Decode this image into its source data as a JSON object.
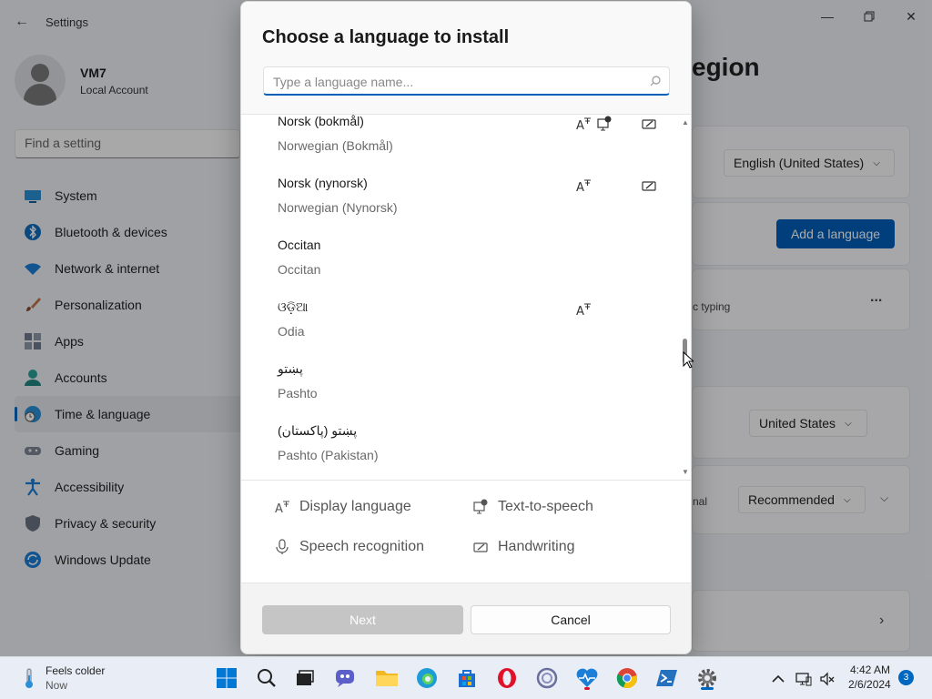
{
  "settings": {
    "title": "Settings",
    "profile": {
      "name": "VM7",
      "account": "Local Account"
    },
    "find_placeholder": "Find a setting",
    "nav": [
      {
        "label": "System",
        "icon": "monitor-icon"
      },
      {
        "label": "Bluetooth & devices",
        "icon": "bluetooth-icon"
      },
      {
        "label": "Network & internet",
        "icon": "wifi-icon"
      },
      {
        "label": "Personalization",
        "icon": "brush-icon"
      },
      {
        "label": "Apps",
        "icon": "apps-icon"
      },
      {
        "label": "Accounts",
        "icon": "person-icon"
      },
      {
        "label": "Time & language",
        "icon": "globe-clock-icon"
      },
      {
        "label": "Gaming",
        "icon": "gamepad-icon"
      },
      {
        "label": "Accessibility",
        "icon": "accessibility-icon"
      },
      {
        "label": "Privacy & security",
        "icon": "shield-icon"
      },
      {
        "label": "Windows Update",
        "icon": "update-icon"
      }
    ],
    "page_title_fragment": "egion",
    "language_select": "English (United States)",
    "add_language_button": "Add a language",
    "typing_fragment": "c typing",
    "more": "...",
    "region_select": "United States",
    "format_fragment": "nal",
    "format_select": "Recommended"
  },
  "dialog": {
    "title": "Choose a language to install",
    "search_placeholder": "Type a language name...",
    "languages": [
      {
        "native": "Norsk (bokmål)",
        "english": "Norwegian (Bokmål)"
      },
      {
        "native": "Norsk (nynorsk)",
        "english": "Norwegian (Nynorsk)"
      },
      {
        "native": "Occitan",
        "english": "Occitan"
      },
      {
        "native": "ଓଡ଼ିଆ",
        "english": "Odia"
      },
      {
        "native": "پښتو",
        "english": "Pashto"
      },
      {
        "native": "پښتو (پاکستان)",
        "english": "Pashto (Pakistan)"
      }
    ],
    "legend": {
      "display_language": "Display language",
      "text_to_speech": "Text-to-speech",
      "speech_recognition": "Speech recognition",
      "handwriting": "Handwriting"
    },
    "next_button": "Next",
    "cancel_button": "Cancel"
  },
  "taskbar": {
    "weather_title": "Feels colder",
    "weather_sub": "Now",
    "time": "4:42 AM",
    "date": "2/6/2024",
    "notification_count": "3"
  },
  "colors": {
    "accent": "#005fb8",
    "dialog_bg": "#f9f9f9",
    "disabled_button": "#c5c5c5"
  }
}
